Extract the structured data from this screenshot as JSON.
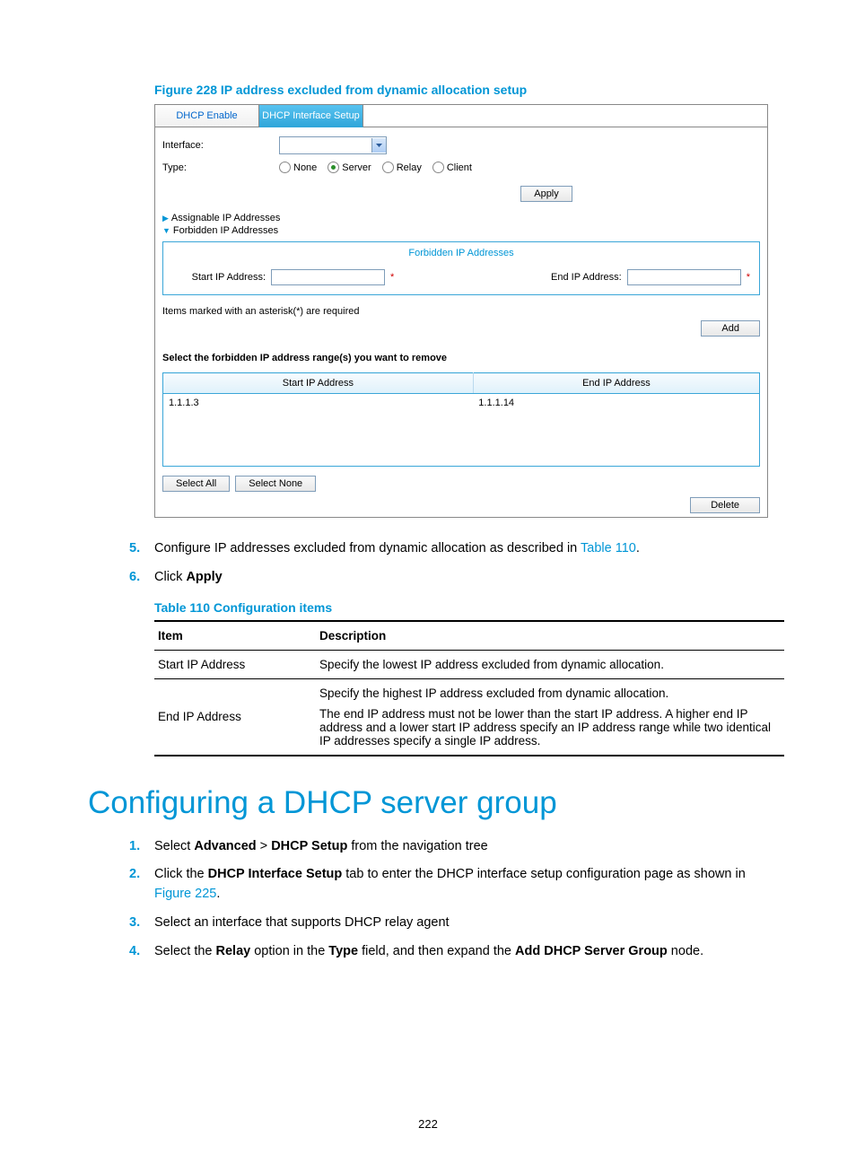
{
  "figure_caption": "Figure 228 IP address excluded from dynamic allocation setup",
  "ui": {
    "tabs": {
      "dhcp_enable": "DHCP Enable",
      "dhcp_iface_setup": "DHCP Interface Setup"
    },
    "labels": {
      "interface": "Interface:",
      "type": "Type:"
    },
    "type_options": {
      "none": "None",
      "server": "Server",
      "relay": "Relay",
      "client": "Client"
    },
    "buttons": {
      "apply": "Apply",
      "add": "Add",
      "select_all": "Select All",
      "select_none": "Select None",
      "delete": "Delete"
    },
    "exp": {
      "assignable": "Assignable IP Addresses",
      "forbidden": "Forbidden IP Addresses"
    },
    "forbidden": {
      "header": "Forbidden IP Addresses",
      "start_label": "Start IP Address:",
      "end_label": "End IP Address:",
      "asterisk": "*"
    },
    "note_required": "Items marked with an asterisk(*) are required",
    "remove_prompt": "Select the forbidden IP address range(s) you want to remove",
    "tbl": {
      "col_start": "Start IP Address",
      "col_end": "End IP Address",
      "rows": [
        {
          "start": "1.1.1.3",
          "end": "1.1.1.14"
        }
      ]
    }
  },
  "steps_a": [
    {
      "n": "5.",
      "pre": "Configure IP addresses excluded from dynamic allocation as described in ",
      "link": "Table 110",
      "post": "."
    },
    {
      "n": "6.",
      "pre": "Click ",
      "bold": "Apply"
    }
  ],
  "table_caption": "Table 110 Configuration items",
  "config_table": {
    "headers": {
      "item": "Item",
      "desc": "Description"
    },
    "rows": [
      {
        "item": "Start IP Address",
        "desc": [
          "Specify the lowest IP address excluded from dynamic allocation."
        ]
      },
      {
        "item": "End IP Address",
        "desc": [
          "Specify the highest IP address excluded from dynamic allocation.",
          "The end IP address must not be lower than the start IP address. A higher end IP address and a lower start IP address specify an IP address range while two identical IP addresses specify a single IP address."
        ]
      }
    ]
  },
  "h1": "Configuring a DHCP server group",
  "steps_b": [
    {
      "n": "1.",
      "parts": [
        {
          "t": "Select "
        },
        {
          "b": "Advanced"
        },
        {
          "t": " > "
        },
        {
          "b": "DHCP Setup"
        },
        {
          "t": " from the navigation tree"
        }
      ]
    },
    {
      "n": "2.",
      "parts": [
        {
          "t": "Click the "
        },
        {
          "b": "DHCP Interface Setup"
        },
        {
          "t": " tab to enter the DHCP interface setup configuration page as shown in "
        },
        {
          "l": "Figure 225"
        },
        {
          "t": "."
        }
      ]
    },
    {
      "n": "3.",
      "parts": [
        {
          "t": "Select an interface that supports DHCP relay agent"
        }
      ]
    },
    {
      "n": "4.",
      "parts": [
        {
          "t": "Select the "
        },
        {
          "b": "Relay"
        },
        {
          "t": " option in the "
        },
        {
          "b": "Type"
        },
        {
          "t": " field, and then expand the "
        },
        {
          "b": "Add DHCP Server Group"
        },
        {
          "t": " node."
        }
      ]
    }
  ],
  "pagenum": "222"
}
